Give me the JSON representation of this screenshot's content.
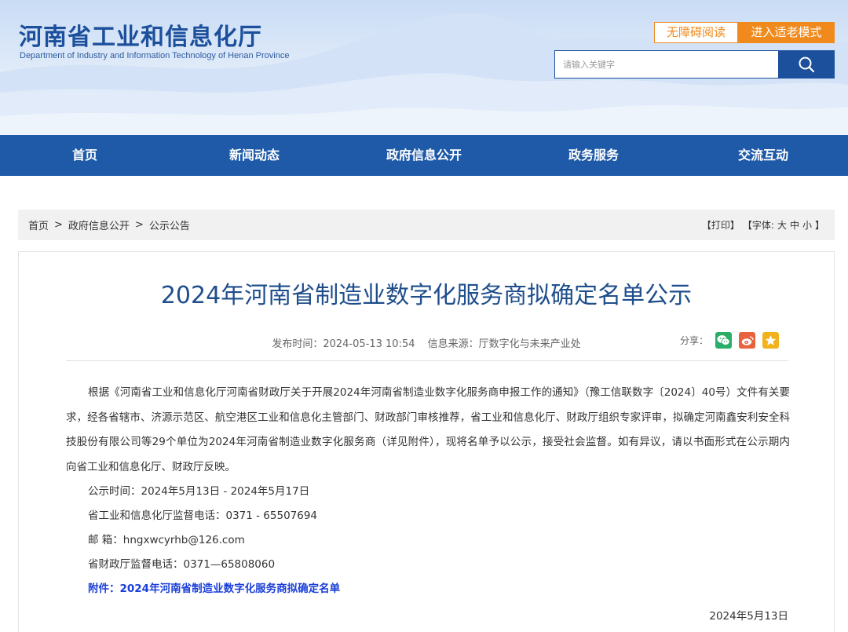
{
  "header": {
    "title": "河南省工业和信息化厅",
    "subtitle": "Department of Industry and Information Technology of Henan Province",
    "accessibility_label": "无障碍阅读",
    "elderly_mode_label": "进入适老模式",
    "search_placeholder": "请输入关键字",
    "brand_color": "#1e5aa8",
    "accent_color": "#f08a1c"
  },
  "nav": {
    "items": [
      "首页",
      "新闻动态",
      "政府信息公开",
      "政务服务",
      "交流互动"
    ]
  },
  "breadcrumb": {
    "items": [
      "首页",
      "政府信息公开",
      "公示公告"
    ],
    "separator": ">"
  },
  "tools": {
    "print": "【打印】",
    "font_prefix": "【字体:",
    "font_large": "大",
    "font_medium": "中",
    "font_small": "小",
    "font_suffix": "】"
  },
  "article": {
    "title": "2024年河南省制造业数字化服务商拟确定名单公示",
    "publish_time": "发布时间：2024-05-13 10:54",
    "source": "信息来源：厅数字化与未来产业处",
    "share_label": "分享：",
    "share_icons": [
      "wechat-icon",
      "weibo-icon",
      "favorite-icon"
    ],
    "paragraph": "根据《河南省工业和信息化厅河南省财政厅关于开展2024年河南省制造业数字化服务商申报工作的通知》（豫工信联数字〔2024〕40号）文件有关要求，经各省辖市、济源示范区、航空港区工业和信息化主管部门、财政部门审核推荐，省工业和信息化厅、财政厅组织专家评审，拟确定河南鑫安利安全科技股份有限公司等29个单位为2024年河南省制造业数字化服务商（详见附件），现将名单予以公示，接受社会监督。如有异议，请以书面形式在公示期内向省工业和信息化厅、财政厅反映。",
    "period": "公示时间：2024年5月13日 - 2024年5月17日",
    "phone_industry": "省工业和信息化厅监督电话：0371 - 65507694",
    "email": "邮 箱：hngxwcyrhb@126.com",
    "phone_finance": "省财政厅监督电话：0371—65808060",
    "attachment": "附件：2024年河南省制造业数字化服务商拟确定名单",
    "date": "2024年5月13日"
  }
}
